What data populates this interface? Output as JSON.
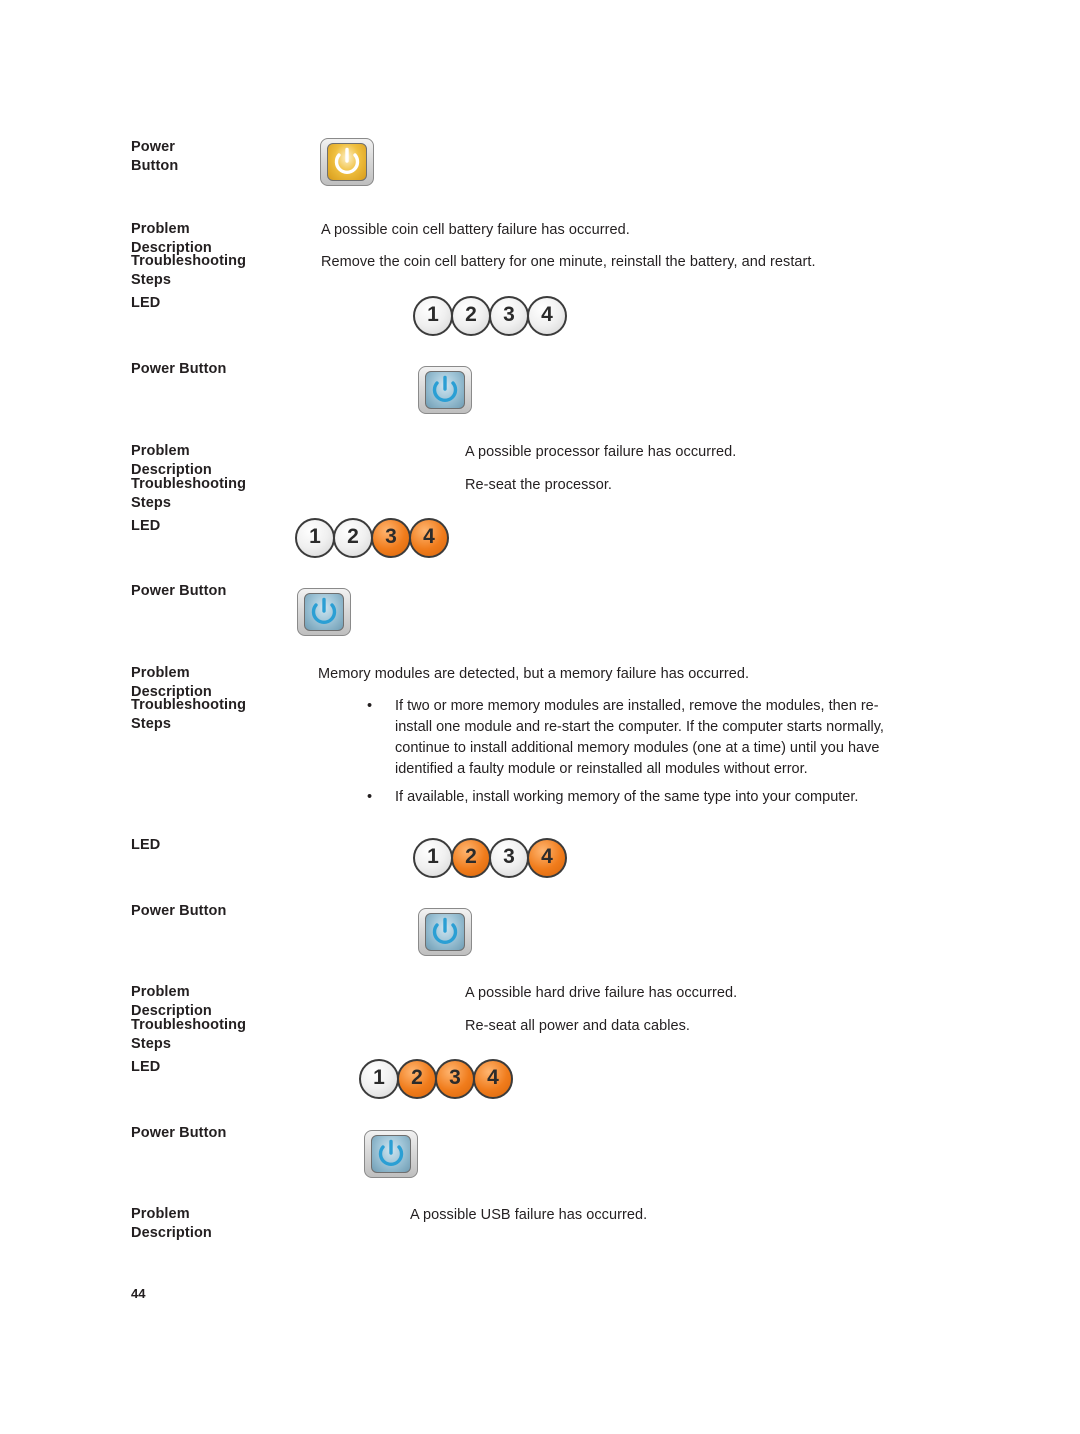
{
  "document": {
    "page_number": "44",
    "labels": {
      "power_button": "Power Button",
      "problem_description": "Problem Description",
      "troubleshooting_steps": "Troubleshooting Steps",
      "led": "LED"
    },
    "led_numbers": [
      "1",
      "2",
      "3",
      "4"
    ],
    "bullet_char": "•"
  },
  "blocks": [
    {
      "id": "block-coin-cell",
      "power_button_color": "amber",
      "problem_description": "A possible coin cell battery failure has occurred.",
      "troubleshooting_steps": "Remove the coin cell battery for one minute, reinstall the battery, and restart.",
      "led_states": [
        "off",
        "off",
        "off",
        "off"
      ]
    },
    {
      "id": "block-processor",
      "power_button_color": "blue",
      "problem_description": "A possible processor failure has occurred.",
      "troubleshooting_steps": "Re-seat the processor.",
      "led_states": [
        "off",
        "off",
        "on",
        "on"
      ]
    },
    {
      "id": "block-memory",
      "power_button_color": "blue",
      "problem_description": "Memory modules are detected, but a memory failure has occurred.",
      "troubleshooting_bullets": [
        "If two or more memory modules are installed, remove the modules, then re-install one module and re-start the computer. If the computer starts normally, continue to install additional memory modules (one at a time) until you have identified a faulty module or reinstalled all modules without error.",
        "If available, install working memory of the same type into your computer."
      ],
      "led_states": [
        "off",
        "on",
        "off",
        "on"
      ]
    },
    {
      "id": "block-hard-drive",
      "power_button_color": "blue",
      "problem_description": "A possible hard drive failure has occurred.",
      "troubleshooting_steps": "Re-seat all power and data cables.",
      "led_states": [
        "off",
        "on",
        "on",
        "on"
      ]
    },
    {
      "id": "block-usb",
      "power_button_color": "blue",
      "problem_description": "A possible USB failure has occurred."
    }
  ]
}
